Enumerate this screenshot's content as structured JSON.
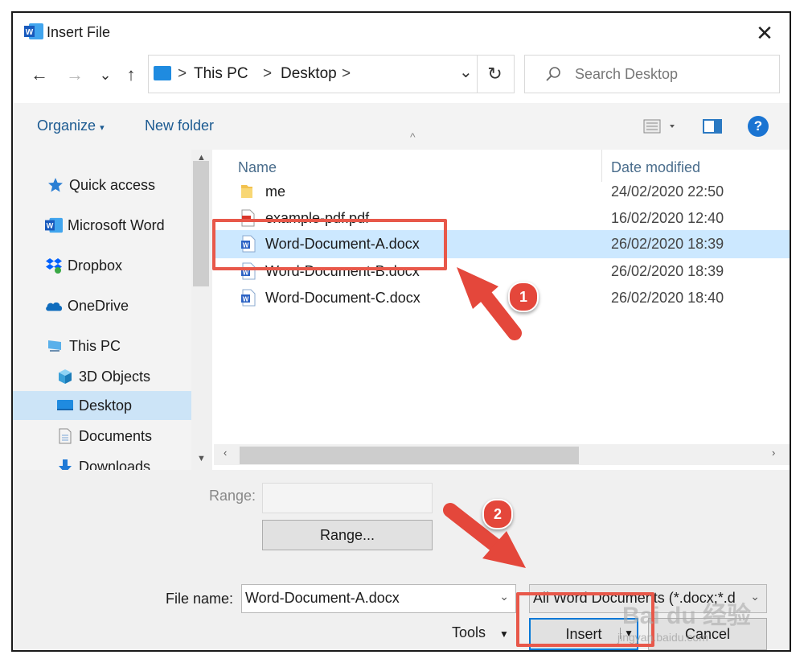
{
  "window": {
    "title": "Insert File",
    "close_glyph": "✕"
  },
  "nav": {
    "back": "←",
    "forward": "→",
    "history": "⌄",
    "up": "↑",
    "breadcrumb": [
      "This PC",
      "Desktop"
    ],
    "separator": ">",
    "dropdown": "⌄",
    "refresh": "↻",
    "search_placeholder": "Search Desktop"
  },
  "toolbar": {
    "organize": "Organize",
    "new_folder": "New folder",
    "help": "?"
  },
  "sidebar": {
    "items": [
      {
        "label": "Quick access",
        "icon": "star-icon"
      },
      {
        "label": "Microsoft Word",
        "icon": "word-icon"
      },
      {
        "label": "Dropbox",
        "icon": "dropbox-icon"
      },
      {
        "label": "OneDrive",
        "icon": "cloud-icon"
      },
      {
        "label": "This PC",
        "icon": "pc-icon"
      },
      {
        "label": "3D Objects",
        "icon": "cube-icon"
      },
      {
        "label": "Desktop",
        "icon": "desktop-icon",
        "selected": true
      },
      {
        "label": "Documents",
        "icon": "document-icon"
      },
      {
        "label": "Downloads",
        "icon": "download-icon"
      }
    ]
  },
  "files": {
    "columns": {
      "name": "Name",
      "date": "Date modified"
    },
    "rows": [
      {
        "name": "me",
        "date": "24/02/2020 22:50",
        "icon": "folder-icon"
      },
      {
        "name": "example-pdf.pdf",
        "date": "16/02/2020 12:40",
        "icon": "pdf-icon"
      },
      {
        "name": "Word-Document-A.docx",
        "date": "26/02/2020 18:39",
        "icon": "word-file-icon",
        "selected": true
      },
      {
        "name": "Word-Document-B.docx",
        "date": "26/02/2020 18:39",
        "icon": "word-file-icon"
      },
      {
        "name": "Word-Document-C.docx",
        "date": "26/02/2020 18:40",
        "icon": "word-file-icon"
      }
    ]
  },
  "bottom": {
    "range_label": "Range:",
    "range_value": "",
    "range_button": "Range...",
    "filename_label": "File name:",
    "filename_value": "Word-Document-A.docx",
    "filetype_value": "All Word Documents (*.docx;*.d",
    "tools": "Tools",
    "insert": "Insert",
    "cancel": "Cancel"
  },
  "annotations": {
    "badge_1": "1",
    "badge_2": "2",
    "color": "#e8584a"
  },
  "watermark": {
    "brand": "Bai du 经验",
    "url": "jingyan.baidu.com"
  }
}
